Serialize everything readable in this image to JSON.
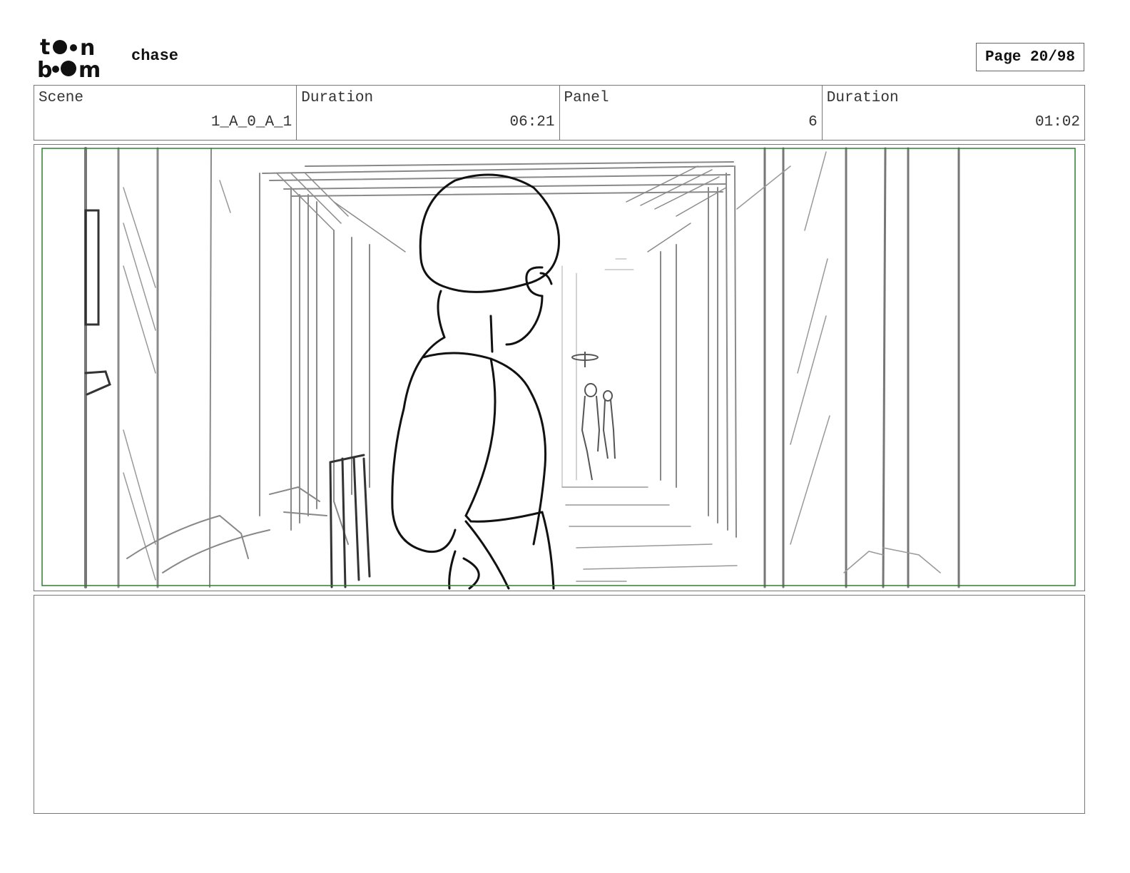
{
  "header": {
    "logo_text_top": "toon",
    "logo_text_bottom": "boom",
    "project_title": "chase",
    "page_label": "Page 20/98"
  },
  "info": {
    "scene_label": "Scene",
    "scene_value": "1_A_0_A_1",
    "scene_duration_label": "Duration",
    "scene_duration_value": "06:21",
    "panel_label": "Panel",
    "panel_value": "6",
    "panel_duration_label": "Duration",
    "panel_duration_value": "01:02"
  },
  "panel": {
    "safe_area_color": "#2e7d32",
    "sketch_color": "#7a7a7a",
    "character_color": "#111111"
  },
  "notes": {
    "text": ""
  }
}
